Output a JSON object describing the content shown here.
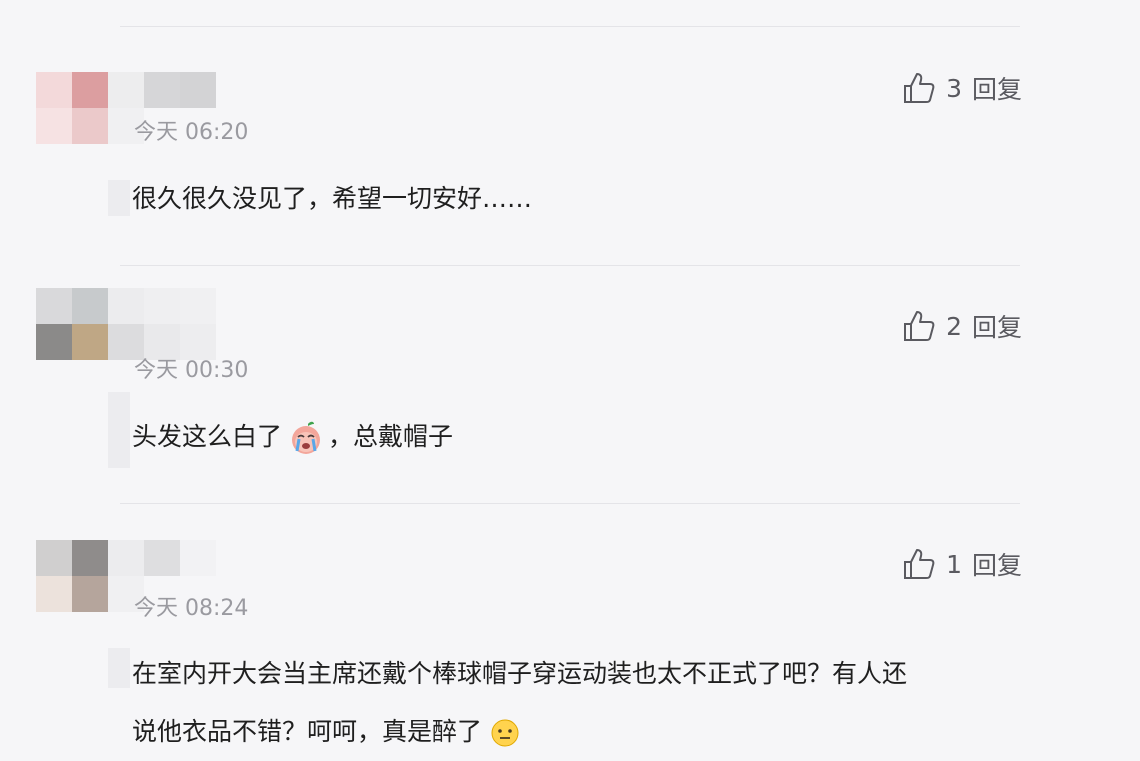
{
  "comments": [
    {
      "timestamp": "今天 06:20",
      "like_count": "3",
      "reply_label": "回复",
      "text": "很久很久没见了，希望一切安好……"
    },
    {
      "timestamp": "今天 00:30",
      "like_count": "2",
      "reply_label": "回复",
      "text_before_emoji": "头发这么白了",
      "emoji_icon": "crying-face-icon",
      "text_after_emoji": "，总戴帽子"
    },
    {
      "timestamp": "今天 08:24",
      "like_count": "1",
      "reply_label": "回复",
      "text_line1": "在室内开大会当主席还戴个棒球帽子穿运动装也太不正式了吧？有人还",
      "text_line2": "说他衣品不错？呵呵，真是醉了",
      "emoji_icon": "neutral-face-icon"
    }
  ],
  "colors": {
    "background": "#f6f6f8",
    "divider": "#e4e4e8",
    "timestamp": "#9a9aa0",
    "action": "#5a5a60",
    "text": "#1f1f1f"
  }
}
